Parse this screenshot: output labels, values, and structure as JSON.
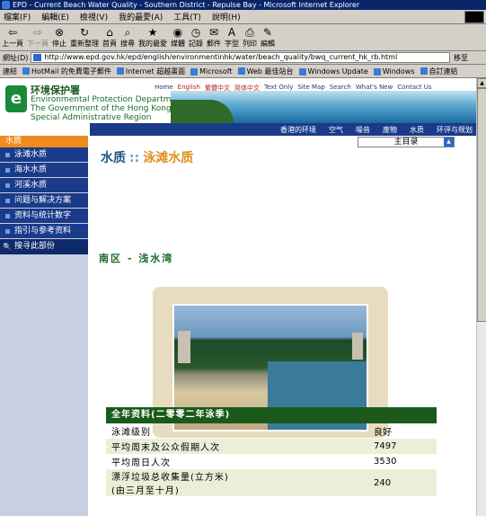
{
  "window": {
    "title": "EPD - Current Beach Water Quality - Southern District - Repulse Bay - Microsoft Internet Explorer"
  },
  "menu": {
    "items": [
      "檔案(F)",
      "編輯(E)",
      "檢視(V)",
      "我的最愛(A)",
      "工具(T)",
      "說明(H)"
    ]
  },
  "toolbar": {
    "back": "上一頁",
    "forward": "下一頁",
    "stop": "停止",
    "refresh": "重新整理",
    "home": "首頁",
    "search": "搜尋",
    "favorites": "我的最愛",
    "media": "媒體",
    "history": "記錄",
    "mail": "郵件",
    "font": "字型",
    "print": "列印",
    "edit": "編輯"
  },
  "address": {
    "label": "網址(D)",
    "url": "http://www.epd.gov.hk/epd/english/environmentinhk/water/beach_quality/bwq_current_hk_rb.html",
    "go": "移至"
  },
  "links": {
    "label": "連結",
    "items": [
      "HotMail 的免費電子郵件",
      "Internet 超越畫面",
      "Microsoft",
      "Web 最佳站台",
      "Windows Update",
      "Windows",
      "自訂連結"
    ]
  },
  "site": {
    "logo_cn": "环境保护署",
    "logo_en": "Environmental Protection Department",
    "gov_line1": "The Government of the Hong Kong",
    "gov_line2": "Special Administrative Region",
    "toplinks": [
      "Home",
      "English",
      "繁體中文",
      "简体中文",
      "Text Only",
      "Site Map",
      "Search",
      "What's New",
      "Contact Us"
    ],
    "nav": [
      "香港的环境",
      "空气",
      "噪音",
      "废物",
      "水质",
      "环评与规划"
    ]
  },
  "leftnav": {
    "head": "水质",
    "items": [
      "泳滩水质",
      "海水水质",
      "河溪水质",
      "问题与解决方案",
      "资料与统计数字",
      "指引与参考资料"
    ],
    "search": "搜寻此部份"
  },
  "dropdown": {
    "label": "主目录"
  },
  "heading": {
    "main": "水质",
    "sep": "::",
    "sub": "泳滩水质"
  },
  "subheading": "南区 - 浅水湾",
  "table": {
    "title": "全年资料(二零零二年泳季)",
    "rows": [
      {
        "label": "泳滩级别",
        "value": "良好"
      },
      {
        "label": "平均周末及公众假期人次",
        "value": "7497"
      },
      {
        "label": "平均周日人次",
        "value": "3530"
      },
      {
        "label": "漂浮垃圾总收集量(立方米)\n(由三月至十月)",
        "value": "240"
      }
    ]
  }
}
